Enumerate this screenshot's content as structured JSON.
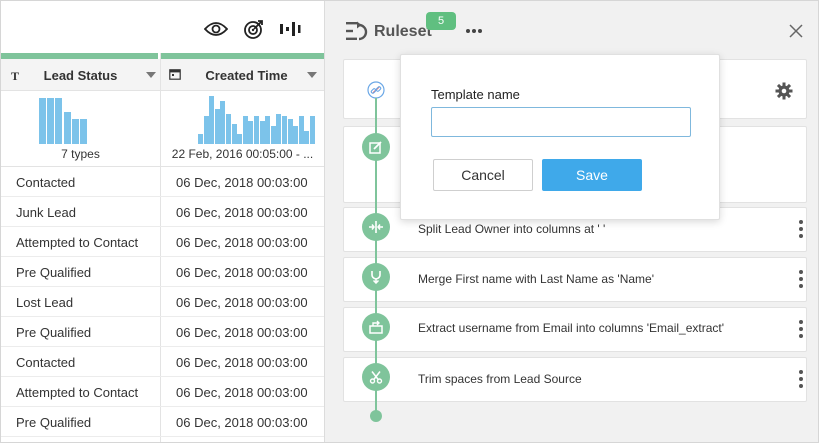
{
  "toolbar": {
    "icons": [
      "eye-icon",
      "target-icon",
      "column-stats-icon"
    ]
  },
  "columns": [
    {
      "type_icon": "T",
      "header": "Lead Status",
      "profile_caption": "7 types",
      "histogram": [
        0.92,
        0.92,
        0.92,
        0.64,
        0.5,
        0.5
      ]
    },
    {
      "type_icon": "calendar-icon",
      "header": "Created Time",
      "profile_caption": "22 Feb, 2016 00:05:00 - ...",
      "histogram": [
        0.2,
        0.55,
        0.95,
        0.7,
        0.85,
        0.6,
        0.4,
        0.2,
        0.55,
        0.45,
        0.55,
        0.45,
        0.55,
        0.35,
        0.6,
        0.55,
        0.5,
        0.35,
        0.55,
        0.25,
        0.55
      ]
    }
  ],
  "rows": [
    {
      "status": "Contacted",
      "created": "06 Dec, 2018 00:03:00"
    },
    {
      "status": "Junk Lead",
      "created": "06 Dec, 2018 00:03:00"
    },
    {
      "status": "Attempted to Contact",
      "created": "06 Dec, 2018 00:03:00"
    },
    {
      "status": "Pre Qualified",
      "created": "06 Dec, 2018 00:03:00"
    },
    {
      "status": "Lost Lead",
      "created": "06 Dec, 2018 00:03:00"
    },
    {
      "status": "Pre Qualified",
      "created": "06 Dec, 2018 00:03:00"
    },
    {
      "status": "Contacted",
      "created": "06 Dec, 2018 00:03:00"
    },
    {
      "status": "Attempted to Contact",
      "created": "06 Dec, 2018 00:03:00"
    },
    {
      "status": "Pre Qualified",
      "created": "06 Dec, 2018 00:03:00"
    }
  ],
  "ruleset": {
    "title": "Ruleset",
    "badge": "5",
    "steps": [
      {
        "label": "Split Lead Owner into columns at ' '",
        "icon": "split-icon"
      },
      {
        "label": "Merge First name with Last Name as 'Name'",
        "icon": "merge-icon"
      },
      {
        "label": "Extract username from Email into columns 'Email_extract'",
        "icon": "extract-icon"
      },
      {
        "label": "Trim spaces from Lead Source",
        "icon": "trim-icon"
      }
    ]
  },
  "popover": {
    "label": "Template name",
    "input_value": "",
    "cancel_label": "Cancel",
    "save_label": "Save"
  },
  "colors": {
    "accent_green": "#7fc49b",
    "badge_green": "#60bf80",
    "bar_blue": "#7cc3ea",
    "save_blue": "#3fa9ea",
    "panel_bg": "#f1f1f1"
  }
}
